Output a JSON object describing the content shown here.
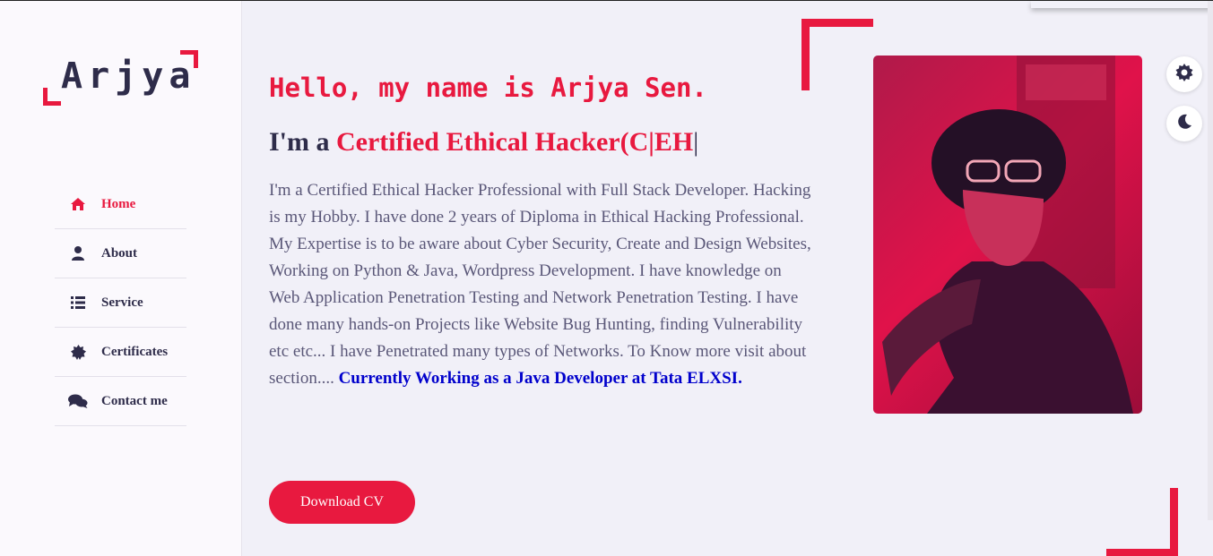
{
  "logo": {
    "text": "Arjya"
  },
  "nav": {
    "items": [
      {
        "label": "Home",
        "icon": "home-icon",
        "active": true
      },
      {
        "label": "About",
        "icon": "user-icon",
        "active": false
      },
      {
        "label": "Service",
        "icon": "list-icon",
        "active": false
      },
      {
        "label": "Certificates",
        "icon": "certificate-icon",
        "active": false
      },
      {
        "label": "Contact me",
        "icon": "comments-icon",
        "active": false
      }
    ]
  },
  "hero": {
    "greeting": "Hello, my name is Arjya Sen.",
    "role_prefix": "I'm a ",
    "role_text": "Certified Ethical Hacker(C|EH",
    "cursor": "|",
    "bio": "I'm a Certified Ethical Hacker Professional with Full Stack Developer. Hacking is my Hobby. I have done 2 years of Diploma in Ethical Hacking Professional. My Expertise is to be aware about Cyber Security, Create and Design Websites, Working on Python & Java, Wordpress Development. I have knowledge on Web Application Penetration Testing and Network Penetration Testing. I have done many hands-on Projects like Website Bug Hunting, finding Vulnerability etc etc... I have Penetrated many types of Networks. To Know more visit about section....",
    "current": "Currently Working as a Java Developer at Tata ELXSI.",
    "cv_button": "Download CV"
  },
  "controls": {
    "settings_icon": "gear-icon",
    "theme_icon": "moon-icon"
  },
  "colors": {
    "accent": "#e8193f",
    "dark": "#2e2c4a",
    "background": "#f1f0f8"
  }
}
